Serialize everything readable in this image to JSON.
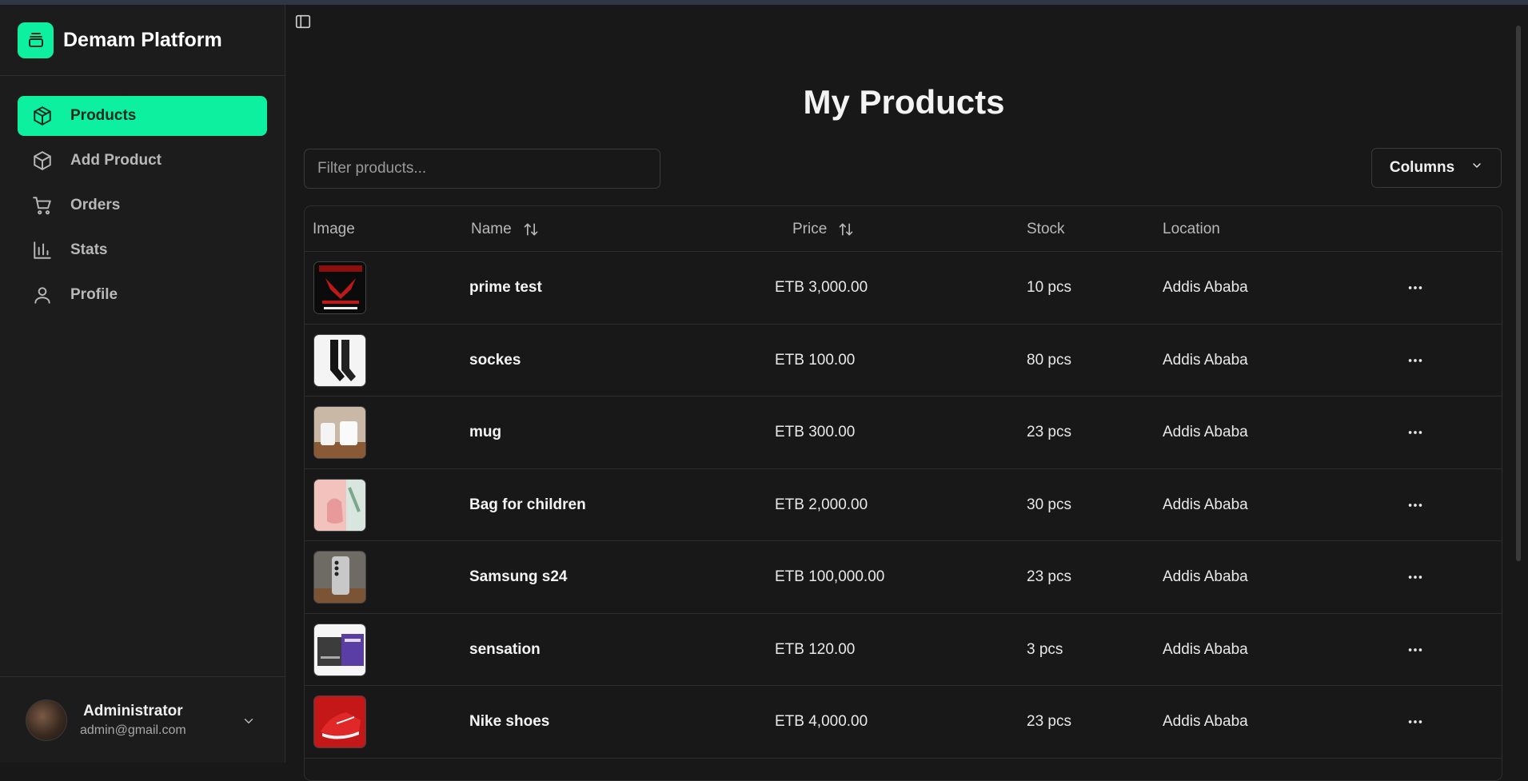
{
  "app": {
    "name": "Demam Platform"
  },
  "sidebar": {
    "items": [
      {
        "label": "Products",
        "icon": "package-icon",
        "active": true
      },
      {
        "label": "Add Product",
        "icon": "package-plus-icon",
        "active": false
      },
      {
        "label": "Orders",
        "icon": "cart-icon",
        "active": false
      },
      {
        "label": "Stats",
        "icon": "bar-chart-icon",
        "active": false
      },
      {
        "label": "Profile",
        "icon": "user-icon",
        "active": false
      }
    ]
  },
  "user": {
    "name": "Administrator",
    "email": "admin@gmail.com"
  },
  "main": {
    "title": "My Products",
    "filter": {
      "placeholder": "Filter products...",
      "value": ""
    },
    "columns_label": "Columns",
    "headers": {
      "image": "Image",
      "name": "Name",
      "price": "Price",
      "stock": "Stock",
      "location": "Location"
    },
    "rows": [
      {
        "name": "prime test",
        "price": "ETB 3,000.00",
        "stock": "10 pcs",
        "location": "Addis Ababa",
        "thumb": "poster"
      },
      {
        "name": "sockes",
        "price": "ETB 100.00",
        "stock": "80 pcs",
        "location": "Addis Ababa",
        "thumb": "socks"
      },
      {
        "name": "mug",
        "price": "ETB 300.00",
        "stock": "23 pcs",
        "location": "Addis Ababa",
        "thumb": "mug"
      },
      {
        "name": "Bag for children",
        "price": "ETB 2,000.00",
        "stock": "30 pcs",
        "location": "Addis Ababa",
        "thumb": "bag"
      },
      {
        "name": "Samsung s24",
        "price": "ETB 100,000.00",
        "stock": "23 pcs",
        "location": "Addis Ababa",
        "thumb": "phone"
      },
      {
        "name": "sensation",
        "price": "ETB 120.00",
        "stock": "3 pcs",
        "location": "Addis Ababa",
        "thumb": "box"
      },
      {
        "name": "Nike shoes",
        "price": "ETB 4,000.00",
        "stock": "23 pcs",
        "location": "Addis Ababa",
        "thumb": "shoe"
      }
    ]
  },
  "colors": {
    "accent": "#0df0a0",
    "background": "#181818",
    "sidebar": "#1c1c1c",
    "border": "#2e2e2e"
  }
}
